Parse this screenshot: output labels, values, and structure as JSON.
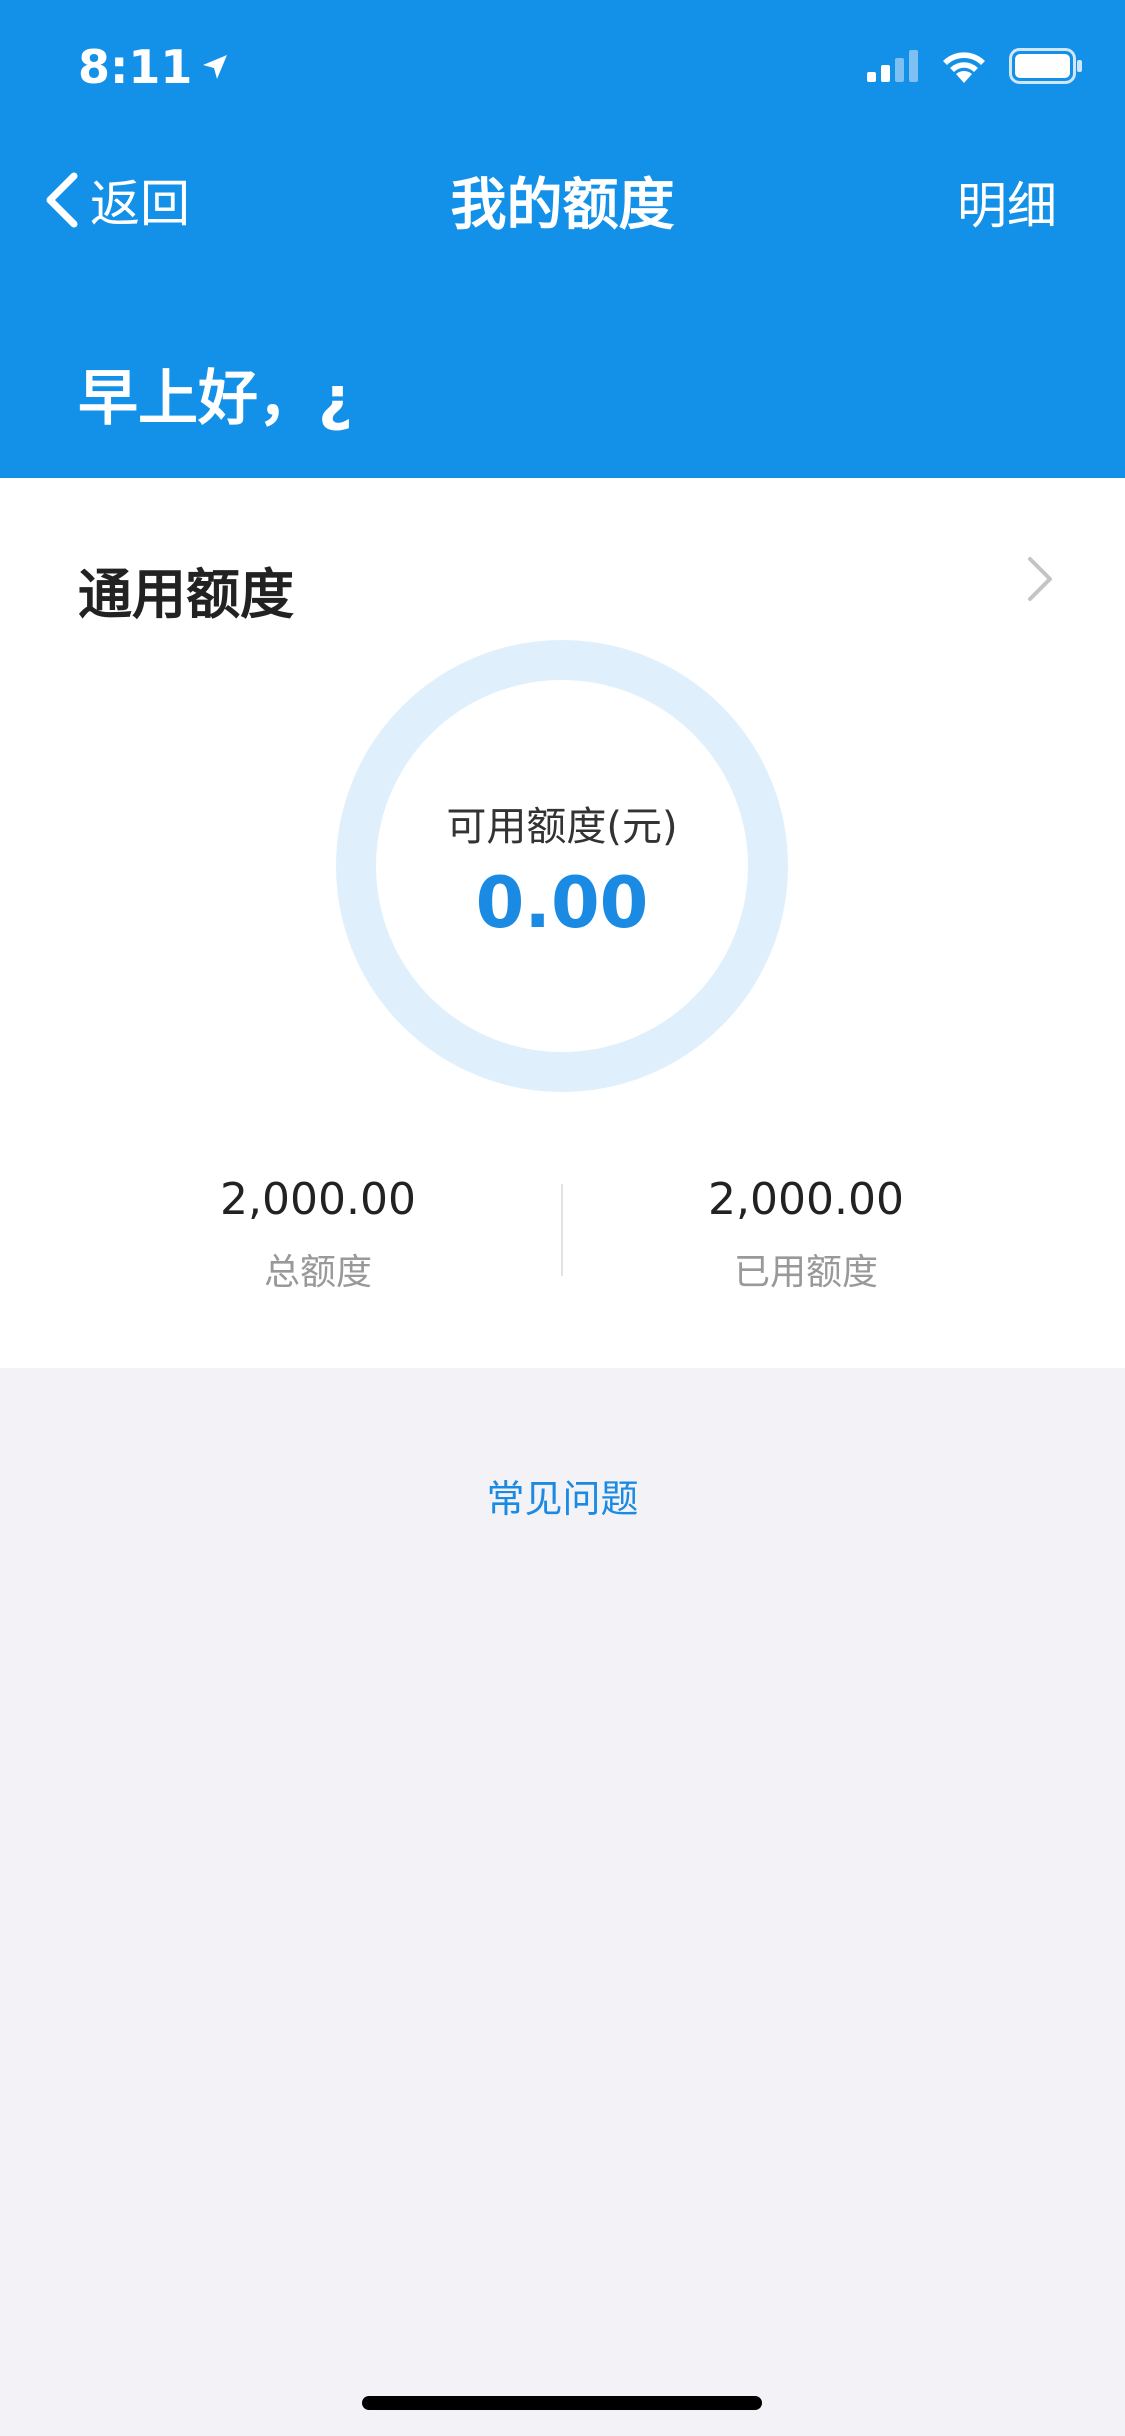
{
  "status_bar": {
    "time": "8:11"
  },
  "nav": {
    "back_label": "返回",
    "title": "我的额度",
    "detail_label": "明细"
  },
  "greeting": "早上好，¿",
  "card": {
    "title": "通用额度",
    "available_label": "可用额度(元)",
    "available_value": "0.00",
    "total_value": "2,000.00",
    "total_label": "总额度",
    "used_value": "2,000.00",
    "used_label": "已用额度"
  },
  "faq_link": "常见问题",
  "colors": {
    "header": "#1390e8",
    "accent": "#1a8ae3",
    "ring": "#dff0fc",
    "background": "#f3f3f7"
  }
}
